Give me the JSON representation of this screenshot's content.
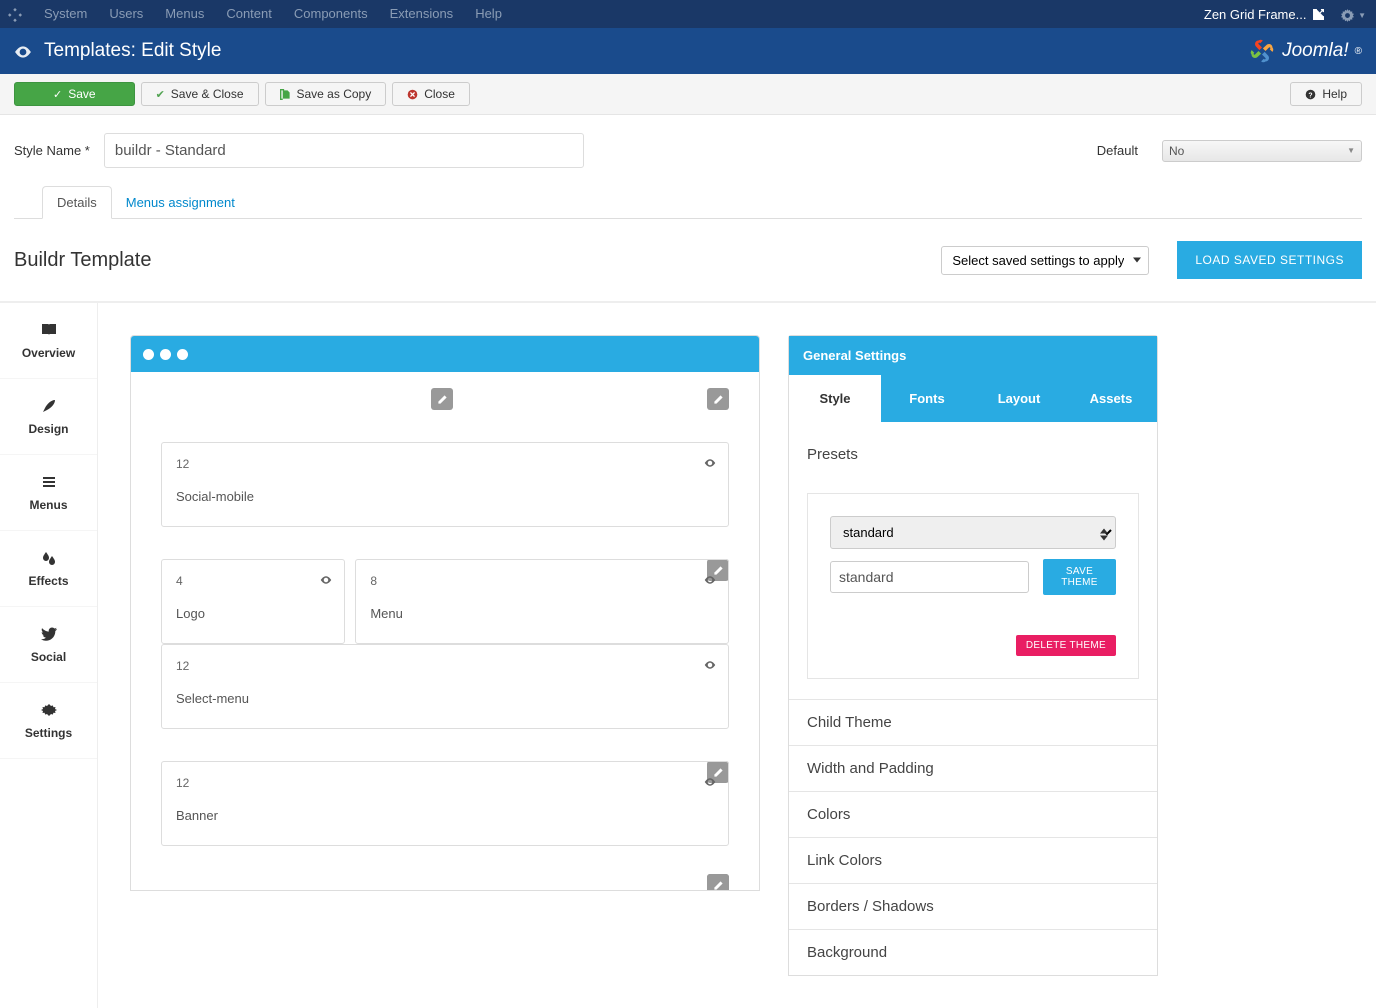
{
  "topnav": {
    "items": [
      "System",
      "Users",
      "Menus",
      "Content",
      "Components",
      "Extensions",
      "Help"
    ],
    "site_name": "Zen Grid Frame..."
  },
  "titlebar": {
    "title": "Templates: Edit Style",
    "brand": "Joomla!"
  },
  "toolbar": {
    "save": "Save",
    "save_close": "Save & Close",
    "save_copy": "Save as Copy",
    "close": "Close",
    "help": "Help"
  },
  "style_name": {
    "label": "Style Name *",
    "value": "buildr - Standard"
  },
  "default": {
    "label": "Default",
    "value": "No"
  },
  "tabs": {
    "details": "Details",
    "menus": "Menus assignment"
  },
  "template": {
    "heading": "Buildr Template",
    "saved_settings_placeholder": "Select saved settings to apply",
    "load_btn": "LOAD SAVED SETTINGS"
  },
  "sidebar": [
    {
      "icon": "book",
      "label": "Overview"
    },
    {
      "icon": "feather",
      "label": "Design"
    },
    {
      "icon": "bars",
      "label": "Menus"
    },
    {
      "icon": "drops",
      "label": "Effects"
    },
    {
      "icon": "twitter",
      "label": "Social"
    },
    {
      "icon": "gear",
      "label": "Settings"
    }
  ],
  "modules": {
    "row1": [
      {
        "w": "12",
        "name": "Social-mobile"
      }
    ],
    "row2": [
      {
        "w": "4",
        "name": "Logo"
      },
      {
        "w": "8",
        "name": "Menu"
      }
    ],
    "row2b": [
      {
        "w": "12",
        "name": "Select-menu"
      }
    ],
    "row3": [
      {
        "w": "12",
        "name": "Banner"
      }
    ]
  },
  "settings_panel": {
    "title": "General Settings",
    "tabs": [
      "Style",
      "Fonts",
      "Layout",
      "Assets"
    ],
    "presets": {
      "heading": "Presets",
      "select_value": "standard",
      "input_value": "standard",
      "save_btn": "SAVE THEME",
      "delete_btn": "DELETE THEME"
    },
    "sections": [
      "Child Theme",
      "Width and Padding",
      "Colors",
      "Link Colors",
      "Borders / Shadows",
      "Background"
    ]
  }
}
